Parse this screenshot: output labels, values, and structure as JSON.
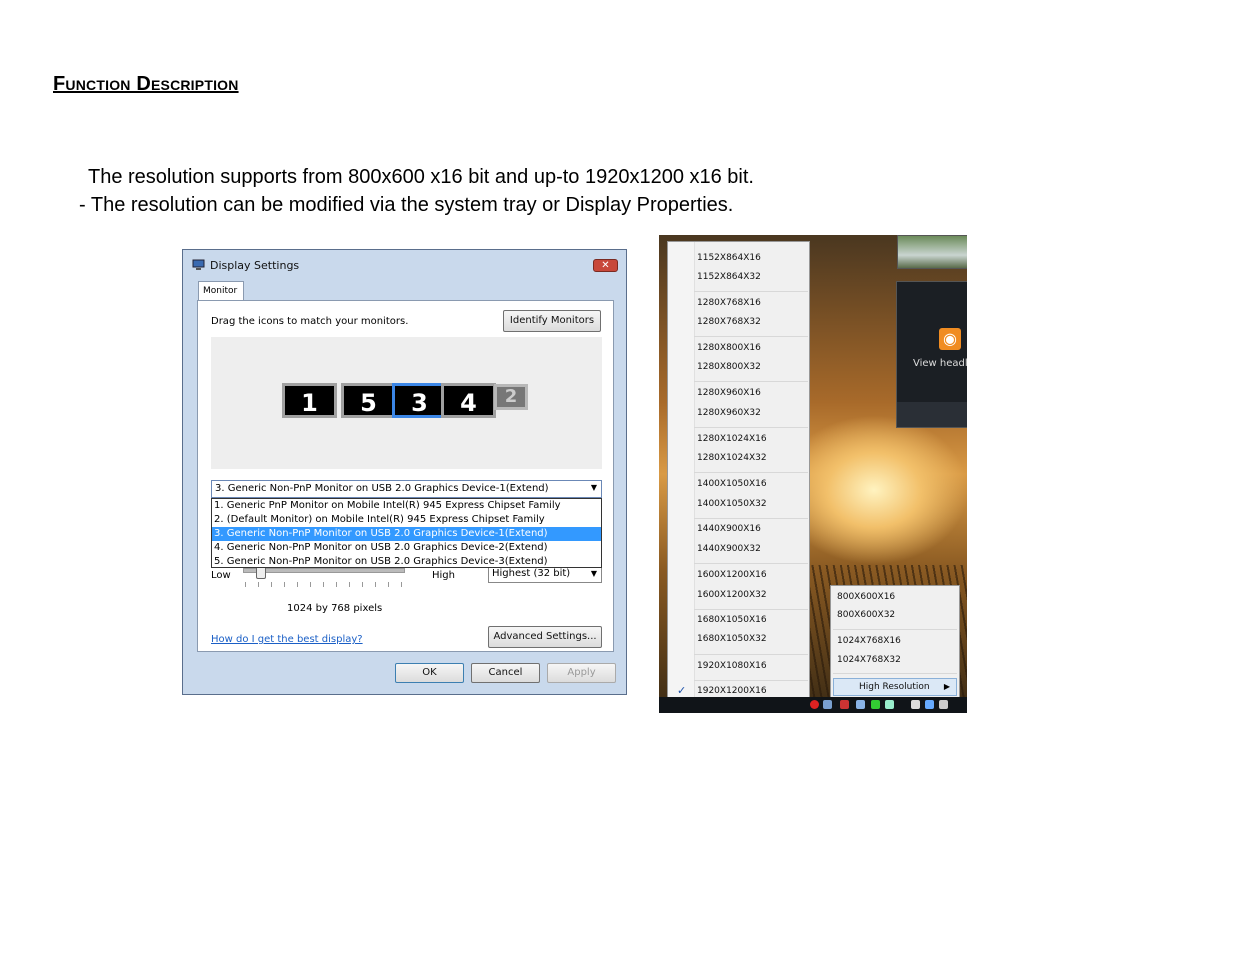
{
  "heading": "Function Description",
  "paragraphs": [
    "The resolution supports from 800x600 x16 bit and up-to 1920x1200 x16 bit.",
    "- The resolution can be modified via the system tray or Display Properties."
  ],
  "dialog": {
    "title": "Display Settings",
    "close": "✕",
    "tab": "Monitor",
    "drag_label": "Drag the icons to match your monitors.",
    "identify_button": "Identify Monitors",
    "monitors": [
      "1",
      "5",
      "3",
      "4",
      "2"
    ],
    "selected_monitor": "3. Generic Non-PnP Monitor on USB 2.0 Graphics Device-1(Extend)",
    "dropdown_items": [
      "1. Generic PnP Monitor on Mobile Intel(R) 945 Express Chipset Family",
      "2. (Default Monitor) on Mobile Intel(R) 945 Express Chipset Family",
      "3. Generic Non-PnP Monitor on USB 2.0 Graphics Device-1(Extend)",
      "4. Generic Non-PnP Monitor on USB 2.0 Graphics Device-2(Extend)",
      "5. Generic Non-PnP Monitor on USB 2.0 Graphics Device-3(Extend)"
    ],
    "low_label": "Low",
    "high_label": "High",
    "color_quality": "Highest (32 bit)",
    "resolution_text": "1024 by 768 pixels",
    "help_link": "How do I get the best display?",
    "advanced_button": "Advanced Settings...",
    "ok_button": "OK",
    "cancel_button": "Cancel",
    "apply_button": "Apply"
  },
  "tray_menu": {
    "items": [
      "1152X864X16",
      "1152X864X32",
      "1280X768X16",
      "1280X768X32",
      "1280X800X16",
      "1280X800X32",
      "1280X960X16",
      "1280X960X32",
      "1280X1024X16",
      "1280X1024X32",
      "1400X1050X16",
      "1400X1050X32",
      "1440X900X16",
      "1440X900X32",
      "1600X1200X16",
      "1600X1200X32",
      "1680X1050X16",
      "1680X1050X32",
      "1920X1080X16",
      "1920X1200X16"
    ],
    "checked_item": "1920X1200X16",
    "check_mark": "✓",
    "submenu_items": [
      "800X600X16",
      "800X600X32",
      "1024X768X16",
      "1024X768X32"
    ],
    "submenu_highlight": "High Resolution",
    "gadget_text": "View headl"
  }
}
